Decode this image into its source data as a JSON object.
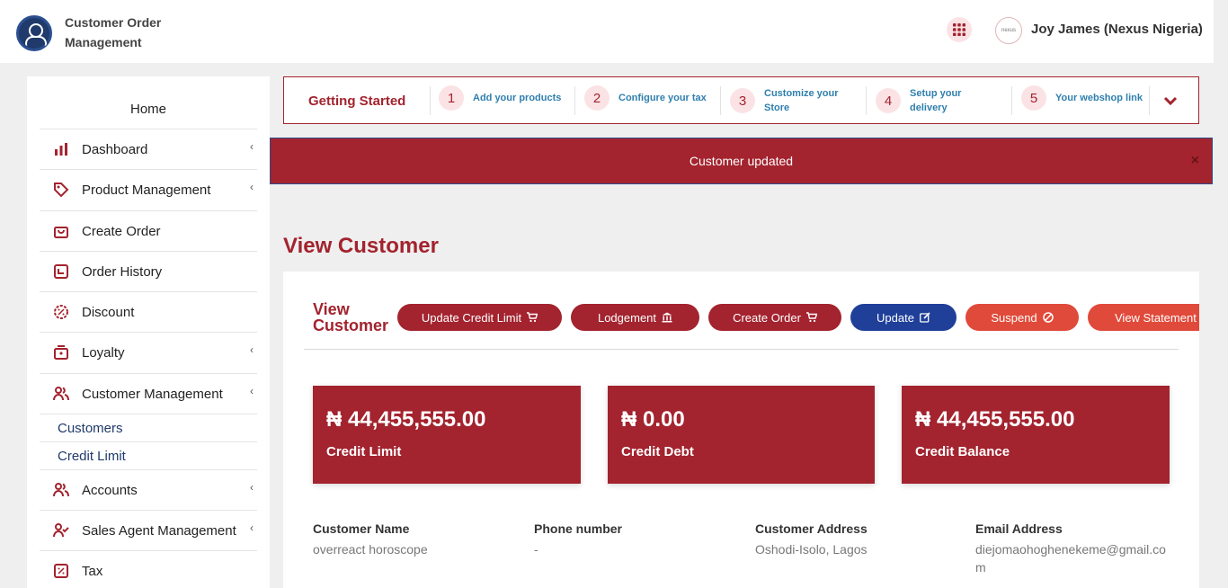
{
  "header": {
    "app_title": "Customer Order Management",
    "avatar_text": "nexus",
    "user_name": "Joy James (Nexus Nigeria)"
  },
  "sidebar": {
    "home": "Home",
    "items": [
      {
        "label": "Dashboard",
        "icon": "bar-chart-icon",
        "chevron": "‹"
      },
      {
        "label": "Product Management",
        "icon": "tag-icon",
        "chevron": "‹"
      },
      {
        "label": "Create Order",
        "icon": "shopping-bag-icon",
        "chevron": ""
      },
      {
        "label": "Order History",
        "icon": "history-icon",
        "chevron": ""
      },
      {
        "label": "Discount",
        "icon": "discount-icon",
        "chevron": ""
      },
      {
        "label": "Loyalty",
        "icon": "gift-icon",
        "chevron": "‹"
      },
      {
        "label": "Customer Management",
        "icon": "users-icon",
        "chevron": "‹"
      }
    ],
    "sub_items": [
      "Customers",
      "Credit Limit"
    ],
    "items_after": [
      {
        "label": "Accounts",
        "icon": "users-icon",
        "chevron": "‹"
      },
      {
        "label": "Sales Agent Management",
        "icon": "user-check-icon",
        "chevron": "‹"
      },
      {
        "label": "Tax",
        "icon": "percent-icon",
        "chevron": ""
      }
    ]
  },
  "getting_started": {
    "title": "Getting Started",
    "steps": [
      {
        "num": "1",
        "label": "Add your products"
      },
      {
        "num": "2",
        "label": "Configure your tax"
      },
      {
        "num": "3",
        "label": "Customize your Store"
      },
      {
        "num": "4",
        "label": "Setup your delivery"
      },
      {
        "num": "5",
        "label": "Your webshop link"
      }
    ]
  },
  "alert": {
    "message": "Customer updated",
    "close": "×"
  },
  "page_title": "View Customer",
  "card": {
    "heading": "View Customer",
    "buttons": [
      {
        "label": "Update Credit Limit",
        "icon": "cart-icon"
      },
      {
        "label": "Lodgement",
        "icon": "bank-icon"
      },
      {
        "label": "Create Order",
        "icon": "cart-icon"
      },
      {
        "label": "Update",
        "icon": "edit-icon"
      },
      {
        "label": "Suspend",
        "icon": "ban-icon"
      },
      {
        "label": "View Statement of Account",
        "icon": ""
      }
    ],
    "stats": [
      {
        "value": "₦ 44,455,555.00",
        "label": "Credit Limit"
      },
      {
        "value": "₦ 0.00",
        "label": "Credit Debt"
      },
      {
        "value": "₦ 44,455,555.00",
        "label": "Credit Balance"
      }
    ],
    "info": [
      {
        "label": "Customer Name",
        "value": "overreact horoscope"
      },
      {
        "label": "Phone number",
        "value": "-"
      },
      {
        "label": "Customer Address",
        "value": "Oshodi-Isolo, Lagos"
      },
      {
        "label": "Email Address",
        "value": "diejomaohoghenekeme@gmail.com"
      }
    ]
  },
  "colors": {
    "brand": "#a3232e",
    "blue": "#1f3f99",
    "orange": "#e04a3a",
    "link": "#2f7fae"
  }
}
